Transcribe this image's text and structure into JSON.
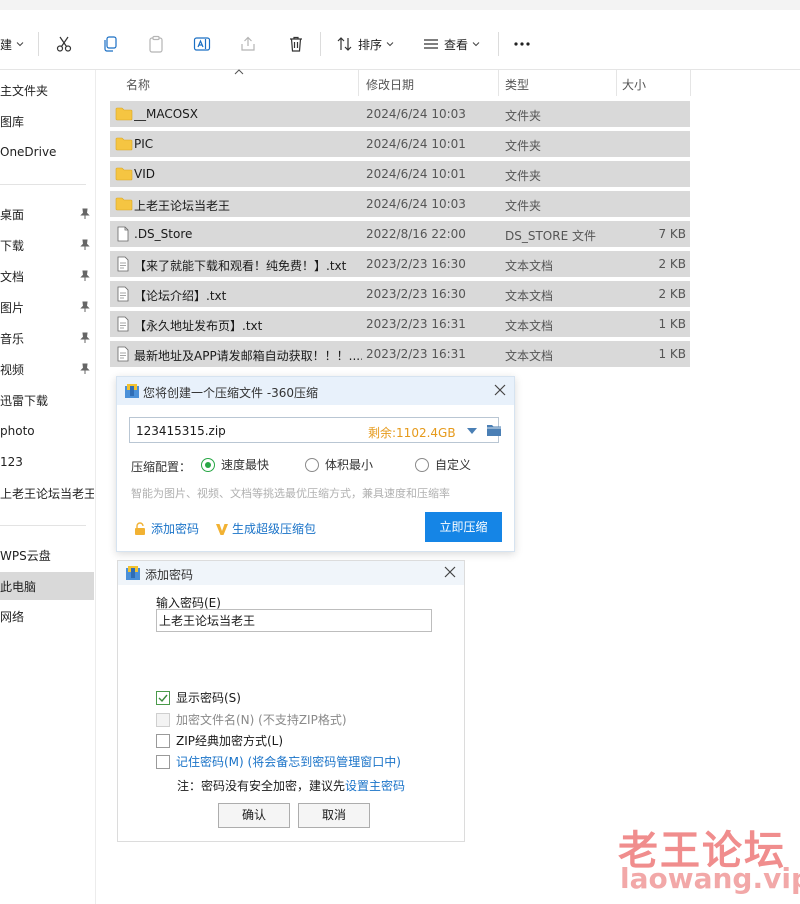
{
  "toolbar": {
    "new_label": "建",
    "sort_label": "排序",
    "view_label": "查看"
  },
  "sidebar": {
    "items": [
      {
        "label": "主文件夹",
        "pinned": false
      },
      {
        "label": "图库",
        "pinned": false
      },
      {
        "label": "OneDrive",
        "pinned": false
      },
      {
        "label": "桌面",
        "pinned": true
      },
      {
        "label": "下载",
        "pinned": true
      },
      {
        "label": "文档",
        "pinned": true
      },
      {
        "label": "图片",
        "pinned": true
      },
      {
        "label": "音乐",
        "pinned": true
      },
      {
        "label": "视频",
        "pinned": true
      },
      {
        "label": "迅雷下载",
        "pinned": false
      },
      {
        "label": "photo",
        "pinned": false
      },
      {
        "label": "123",
        "pinned": false
      },
      {
        "label": "上老王论坛当老王",
        "pinned": false
      },
      {
        "label": "WPS云盘",
        "pinned": false
      },
      {
        "label": "此电脑",
        "pinned": false,
        "selected": true
      },
      {
        "label": "网络",
        "pinned": false
      }
    ]
  },
  "file_list": {
    "headers": {
      "name": "名称",
      "date": "修改日期",
      "type": "类型",
      "size": "大小"
    },
    "rows": [
      {
        "name": "__MACOSX",
        "date": "2024/6/24 10:03",
        "type": "文件夹",
        "size": "",
        "kind": "folder"
      },
      {
        "name": "PIC",
        "date": "2024/6/24 10:01",
        "type": "文件夹",
        "size": "",
        "kind": "folder"
      },
      {
        "name": "VID",
        "date": "2024/6/24 10:01",
        "type": "文件夹",
        "size": "",
        "kind": "folder"
      },
      {
        "name": "上老王论坛当老王",
        "date": "2024/6/24 10:03",
        "type": "文件夹",
        "size": "",
        "kind": "folder"
      },
      {
        "name": ".DS_Store",
        "date": "2022/8/16 22:00",
        "type": "DS_STORE 文件",
        "size": "7 KB",
        "kind": "file"
      },
      {
        "name": "【来了就能下载和观看！纯免费！】.txt",
        "date": "2023/2/23 16:30",
        "type": "文本文档",
        "size": "2 KB",
        "kind": "file"
      },
      {
        "name": "【论坛介绍】.txt",
        "date": "2023/2/23 16:30",
        "type": "文本文档",
        "size": "2 KB",
        "kind": "file"
      },
      {
        "name": "【永久地址发布页】.txt",
        "date": "2023/2/23 16:31",
        "type": "文本文档",
        "size": "1 KB",
        "kind": "file"
      },
      {
        "name": "最新地址及APP请发邮箱自动获取！！！....",
        "date": "2023/2/23 16:31",
        "type": "文本文档",
        "size": "1 KB",
        "kind": "file"
      }
    ]
  },
  "compress_dialog": {
    "title": "您将创建一个压缩文件 -360压缩",
    "filename": "123415315.zip",
    "free_space": "剩余:1102.4GB",
    "config_label": "压缩配置：",
    "options": [
      {
        "label": "速度最快",
        "selected": true
      },
      {
        "label": "体积最小",
        "selected": false
      },
      {
        "label": "自定义",
        "selected": false
      }
    ],
    "hint": "智能为图片、视频、文档等挑选最优压缩方式，兼具速度和压缩率",
    "add_password_link": "添加密码",
    "super_compress_link": "生成超级压缩包",
    "compress_button": "立即压缩"
  },
  "password_dialog": {
    "title": "添加密码",
    "input_label": "输入密码(E)",
    "password_value": "上老王论坛当老王",
    "checkboxes": [
      {
        "label": "显示密码(S)",
        "checked": true,
        "disabled": false,
        "style": "normal"
      },
      {
        "label": "加密文件名(N) (不支持ZIP格式)",
        "checked": false,
        "disabled": true,
        "style": "normal"
      },
      {
        "label": "ZIP经典加密方式(L)",
        "checked": false,
        "disabled": false,
        "style": "normal"
      },
      {
        "label": "记住密码(M) (将会备忘到密码管理窗口中)",
        "checked": false,
        "disabled": false,
        "style": "link"
      }
    ],
    "note_prefix": "注：密码没有安全加密，建议先",
    "note_link": "设置主密码",
    "ok_button": "确认",
    "cancel_button": "取消"
  },
  "watermark": {
    "line1": "老王论坛",
    "line2": "laowang.vip"
  }
}
